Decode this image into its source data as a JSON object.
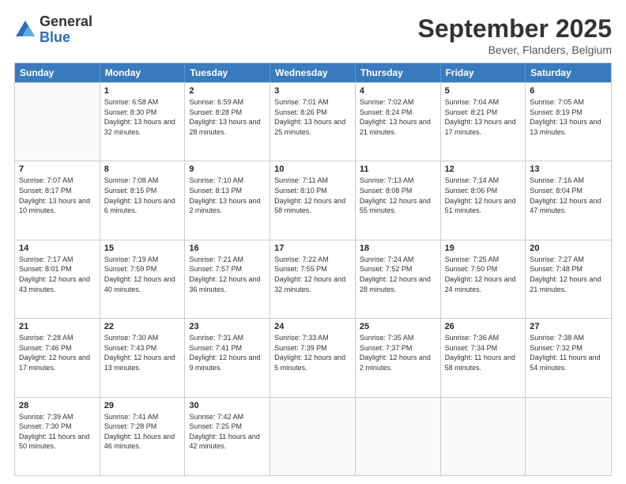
{
  "logo": {
    "general": "General",
    "blue": "Blue"
  },
  "title": {
    "month": "September 2025",
    "location": "Bever, Flanders, Belgium"
  },
  "header_days": [
    "Sunday",
    "Monday",
    "Tuesday",
    "Wednesday",
    "Thursday",
    "Friday",
    "Saturday"
  ],
  "weeks": [
    [
      {
        "day": "",
        "empty": true
      },
      {
        "day": "1",
        "sunrise": "Sunrise: 6:58 AM",
        "sunset": "Sunset: 8:30 PM",
        "daylight": "Daylight: 13 hours and 32 minutes."
      },
      {
        "day": "2",
        "sunrise": "Sunrise: 6:59 AM",
        "sunset": "Sunset: 8:28 PM",
        "daylight": "Daylight: 13 hours and 28 minutes."
      },
      {
        "day": "3",
        "sunrise": "Sunrise: 7:01 AM",
        "sunset": "Sunset: 8:26 PM",
        "daylight": "Daylight: 13 hours and 25 minutes."
      },
      {
        "day": "4",
        "sunrise": "Sunrise: 7:02 AM",
        "sunset": "Sunset: 8:24 PM",
        "daylight": "Daylight: 13 hours and 21 minutes."
      },
      {
        "day": "5",
        "sunrise": "Sunrise: 7:04 AM",
        "sunset": "Sunset: 8:21 PM",
        "daylight": "Daylight: 13 hours and 17 minutes."
      },
      {
        "day": "6",
        "sunrise": "Sunrise: 7:05 AM",
        "sunset": "Sunset: 8:19 PM",
        "daylight": "Daylight: 13 hours and 13 minutes."
      }
    ],
    [
      {
        "day": "7",
        "sunrise": "Sunrise: 7:07 AM",
        "sunset": "Sunset: 8:17 PM",
        "daylight": "Daylight: 13 hours and 10 minutes."
      },
      {
        "day": "8",
        "sunrise": "Sunrise: 7:08 AM",
        "sunset": "Sunset: 8:15 PM",
        "daylight": "Daylight: 13 hours and 6 minutes."
      },
      {
        "day": "9",
        "sunrise": "Sunrise: 7:10 AM",
        "sunset": "Sunset: 8:13 PM",
        "daylight": "Daylight: 13 hours and 2 minutes."
      },
      {
        "day": "10",
        "sunrise": "Sunrise: 7:11 AM",
        "sunset": "Sunset: 8:10 PM",
        "daylight": "Daylight: 12 hours and 58 minutes."
      },
      {
        "day": "11",
        "sunrise": "Sunrise: 7:13 AM",
        "sunset": "Sunset: 8:08 PM",
        "daylight": "Daylight: 12 hours and 55 minutes."
      },
      {
        "day": "12",
        "sunrise": "Sunrise: 7:14 AM",
        "sunset": "Sunset: 8:06 PM",
        "daylight": "Daylight: 12 hours and 51 minutes."
      },
      {
        "day": "13",
        "sunrise": "Sunrise: 7:16 AM",
        "sunset": "Sunset: 8:04 PM",
        "daylight": "Daylight: 12 hours and 47 minutes."
      }
    ],
    [
      {
        "day": "14",
        "sunrise": "Sunrise: 7:17 AM",
        "sunset": "Sunset: 8:01 PM",
        "daylight": "Daylight: 12 hours and 43 minutes."
      },
      {
        "day": "15",
        "sunrise": "Sunrise: 7:19 AM",
        "sunset": "Sunset: 7:59 PM",
        "daylight": "Daylight: 12 hours and 40 minutes."
      },
      {
        "day": "16",
        "sunrise": "Sunrise: 7:21 AM",
        "sunset": "Sunset: 7:57 PM",
        "daylight": "Daylight: 12 hours and 36 minutes."
      },
      {
        "day": "17",
        "sunrise": "Sunrise: 7:22 AM",
        "sunset": "Sunset: 7:55 PM",
        "daylight": "Daylight: 12 hours and 32 minutes."
      },
      {
        "day": "18",
        "sunrise": "Sunrise: 7:24 AM",
        "sunset": "Sunset: 7:52 PM",
        "daylight": "Daylight: 12 hours and 28 minutes."
      },
      {
        "day": "19",
        "sunrise": "Sunrise: 7:25 AM",
        "sunset": "Sunset: 7:50 PM",
        "daylight": "Daylight: 12 hours and 24 minutes."
      },
      {
        "day": "20",
        "sunrise": "Sunrise: 7:27 AM",
        "sunset": "Sunset: 7:48 PM",
        "daylight": "Daylight: 12 hours and 21 minutes."
      }
    ],
    [
      {
        "day": "21",
        "sunrise": "Sunrise: 7:28 AM",
        "sunset": "Sunset: 7:46 PM",
        "daylight": "Daylight: 12 hours and 17 minutes."
      },
      {
        "day": "22",
        "sunrise": "Sunrise: 7:30 AM",
        "sunset": "Sunset: 7:43 PM",
        "daylight": "Daylight: 12 hours and 13 minutes."
      },
      {
        "day": "23",
        "sunrise": "Sunrise: 7:31 AM",
        "sunset": "Sunset: 7:41 PM",
        "daylight": "Daylight: 12 hours and 9 minutes."
      },
      {
        "day": "24",
        "sunrise": "Sunrise: 7:33 AM",
        "sunset": "Sunset: 7:39 PM",
        "daylight": "Daylight: 12 hours and 5 minutes."
      },
      {
        "day": "25",
        "sunrise": "Sunrise: 7:35 AM",
        "sunset": "Sunset: 7:37 PM",
        "daylight": "Daylight: 12 hours and 2 minutes."
      },
      {
        "day": "26",
        "sunrise": "Sunrise: 7:36 AM",
        "sunset": "Sunset: 7:34 PM",
        "daylight": "Daylight: 11 hours and 58 minutes."
      },
      {
        "day": "27",
        "sunrise": "Sunrise: 7:38 AM",
        "sunset": "Sunset: 7:32 PM",
        "daylight": "Daylight: 11 hours and 54 minutes."
      }
    ],
    [
      {
        "day": "28",
        "sunrise": "Sunrise: 7:39 AM",
        "sunset": "Sunset: 7:30 PM",
        "daylight": "Daylight: 11 hours and 50 minutes."
      },
      {
        "day": "29",
        "sunrise": "Sunrise: 7:41 AM",
        "sunset": "Sunset: 7:28 PM",
        "daylight": "Daylight: 11 hours and 46 minutes."
      },
      {
        "day": "30",
        "sunrise": "Sunrise: 7:42 AM",
        "sunset": "Sunset: 7:25 PM",
        "daylight": "Daylight: 11 hours and 42 minutes."
      },
      {
        "day": "",
        "empty": true
      },
      {
        "day": "",
        "empty": true
      },
      {
        "day": "",
        "empty": true
      },
      {
        "day": "",
        "empty": true
      }
    ]
  ]
}
